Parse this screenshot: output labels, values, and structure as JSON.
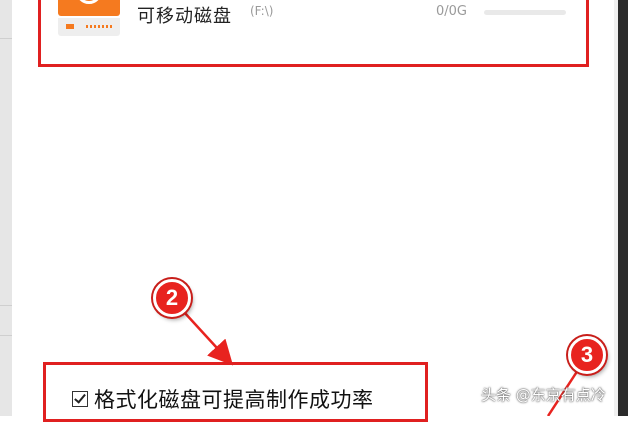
{
  "drive": {
    "name": "可移动磁盘",
    "path": "(F:\\)",
    "capacity": "0/0G",
    "usage_fraction": 0
  },
  "options": {
    "format_checkbox_label": "格式化磁盘可提高制作成功率",
    "format_checked": true
  },
  "markers": {
    "step2": "2",
    "step3": "3"
  },
  "watermark": "头条 @东京有点冷",
  "colors": {
    "accent": "#f57a1f",
    "highlight": "#e02020",
    "marker": "#e8231f"
  }
}
